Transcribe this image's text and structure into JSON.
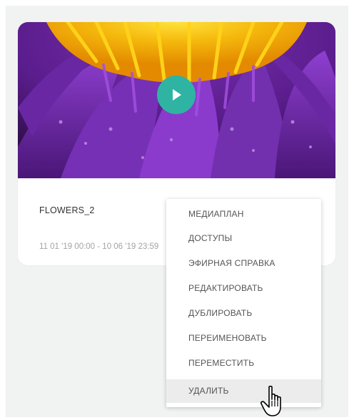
{
  "card": {
    "title": "FLOWERS_2",
    "dates": "11 01 '19 00:00 - 10 06 '19 23:59"
  },
  "context_menu": {
    "items": [
      "МЕДИАПЛАН",
      "ДОСТУПЫ",
      "ЭФИРНАЯ СПРАВКА",
      "РЕДАКТИРОВАТЬ",
      "ДУБЛИРОВАТЬ",
      "ПЕРЕИМЕНОВАТЬ",
      "ПЕРЕМЕСТИТЬ",
      "УДАЛИТЬ"
    ],
    "hovered_item": "УДАЛИТЬ"
  },
  "icons": {
    "play": "play-icon",
    "cursor": "hand-pointer-icon"
  },
  "colors": {
    "panel_background": "#f1f2f2",
    "play_button": "#2fb4a4",
    "menu_hover": "#ececec"
  }
}
